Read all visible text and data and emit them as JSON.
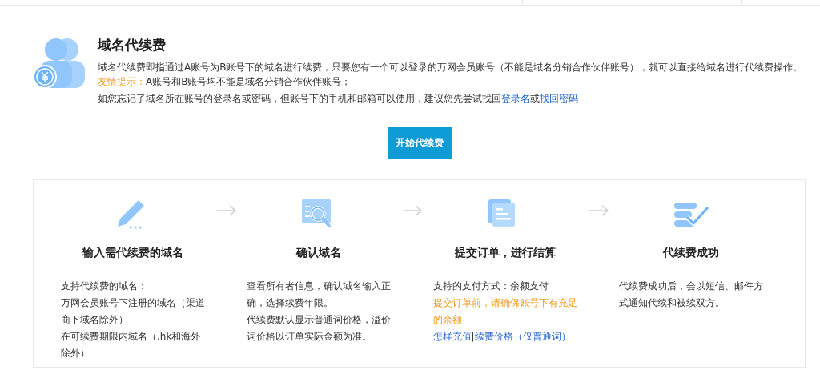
{
  "intro": {
    "title": "域名代续费",
    "lines": [
      [
        {
          "kind": "plain",
          "text": "域名代续费即指通过A账号为B账号下的域名进行续费，只要您有一个可以登录的万网会员账号（不能是域名分销合作伙伴账号），就可以直接给域名进行代续费操作。"
        }
      ],
      [
        {
          "kind": "warn",
          "text": "友情提示："
        },
        {
          "kind": "plain",
          "text": "A账号和B账号均不能是域名分销合作伙伴账号；"
        }
      ],
      [
        {
          "kind": "plain",
          "text": "如您忘记了域名所在账号的登录名或密码，但账号下的手机和邮箱可以使用，建议您先尝试找回"
        },
        {
          "kind": "link",
          "text": "登录名"
        },
        {
          "kind": "plain",
          "text": "或"
        },
        {
          "kind": "link",
          "text": "找回密码"
        }
      ]
    ]
  },
  "start_button": "开始代续费",
  "steps": [
    {
      "kind": "pencil",
      "title": "输入需代续费的域名",
      "lines": [
        [
          {
            "kind": "plain",
            "text": "支持代续费的域名："
          }
        ],
        [
          {
            "kind": "plain",
            "text": "万网会员账号下注册的域名（渠道商下域名除外）"
          }
        ],
        [
          {
            "kind": "plain",
            "text": "在可续费期限内域名（.hk和海外除外）"
          }
        ]
      ]
    },
    {
      "kind": "search",
      "title": "确认域名",
      "lines": [
        [
          {
            "kind": "plain",
            "text": "查看所有者信息，确认域名输入正确，选择续费年限。"
          }
        ],
        [
          {
            "kind": "plain",
            "text": "代续费默认显示普通词价格，溢价词价格以订单实际金额为准。"
          }
        ]
      ]
    },
    {
      "kind": "document",
      "title": "提交订单，进行结算",
      "lines": [
        [
          {
            "kind": "plain",
            "text": "支持的支付方式：余额支付"
          }
        ],
        [
          {
            "kind": "warn",
            "text": "提交订单前，请确保账号下有充足的余额"
          }
        ],
        [
          {
            "kind": "link",
            "text": "怎样充值"
          },
          {
            "kind": "plain",
            "text": "|"
          },
          {
            "kind": "link",
            "text": "续费价格（仅普通词）"
          }
        ]
      ]
    },
    {
      "kind": "check",
      "title": "代续费成功",
      "lines": [
        [
          {
            "kind": "plain",
            "text": "代续费成功后，会以短信、邮件方式通知代续和被续双方。"
          }
        ]
      ]
    }
  ]
}
